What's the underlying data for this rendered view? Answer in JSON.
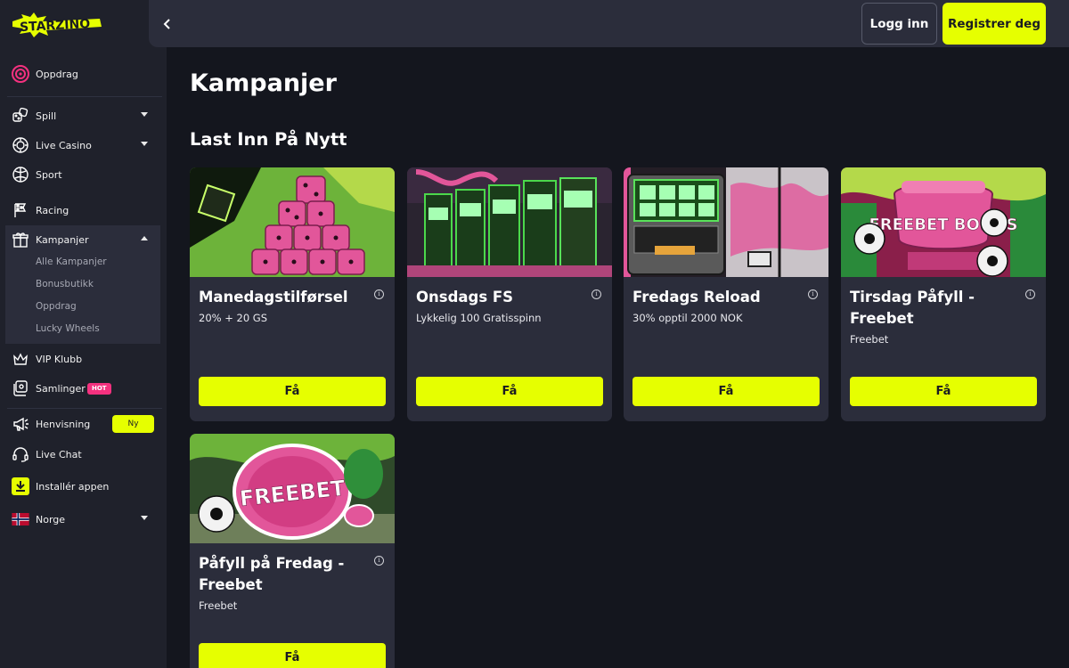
{
  "brand": {
    "logo_text": "STARZINO",
    "accent_color": "#e6ff00",
    "pink_color": "#f5317f"
  },
  "sidebar": {
    "missions": {
      "label": "Oppdrag",
      "icon": "target-icon"
    },
    "items": [
      {
        "label": "Spill",
        "icon": "dice-icon",
        "expandable": true
      },
      {
        "label": "Live Casino",
        "icon": "chip-icon",
        "expandable": true
      },
      {
        "label": "Sport",
        "icon": "ball-icon",
        "expandable": false
      },
      {
        "label": "Racing",
        "icon": "flag-icon",
        "expandable": false
      },
      {
        "label": "Kampanjer",
        "icon": "gift-icon",
        "expandable": true,
        "expanded": true
      }
    ],
    "submenu": [
      "Alle Kampanjer",
      "Bonusbutikk",
      "Oppdrag",
      "Lucky Wheels"
    ],
    "lower_items": [
      {
        "label": "VIP Klubb",
        "icon": "crown-icon"
      },
      {
        "label": "Samlinger",
        "icon": "collection-icon",
        "badge": "HOT"
      },
      {
        "label": "Henvisning",
        "icon": "megaphone-icon",
        "badge": "Ny"
      },
      {
        "label": "Live Chat",
        "icon": "headset-icon"
      },
      {
        "label": "Installér appen",
        "icon": "download-icon"
      },
      {
        "label": "Norge",
        "icon": "norway-flag-icon",
        "expandable": true
      }
    ]
  },
  "topbar": {
    "login_label": "Logg inn",
    "register_label": "Registrer deg"
  },
  "main": {
    "page_title": "Kampanjer",
    "section_title": "Last Inn På Nytt",
    "cards": [
      {
        "title": "Manedagstilførsel",
        "subtitle": "20% + 20 GS",
        "button": "Få",
        "image": "pink-dice-graffiti"
      },
      {
        "title": "Onsdags FS",
        "subtitle": "Lykkelig 100 Gratisspinn",
        "button": "Få",
        "image": "slot-machines-graffiti"
      },
      {
        "title": "Fredags Reload",
        "subtitle": "30% opptil 2000 NOK",
        "button": "Få",
        "image": "slot-machine-closeup"
      },
      {
        "title": "Tirsdag Påfyll - Freebet",
        "subtitle": "Freebet",
        "button": "Få",
        "image": "freebet-bonus-trophy",
        "image_text": "FREEBET BONUS"
      },
      {
        "title": "Påfyll på Fredag - Freebet",
        "subtitle": "Freebet",
        "button": "Få",
        "image": "freebet-chip",
        "image_text": "FREEBET"
      }
    ]
  }
}
